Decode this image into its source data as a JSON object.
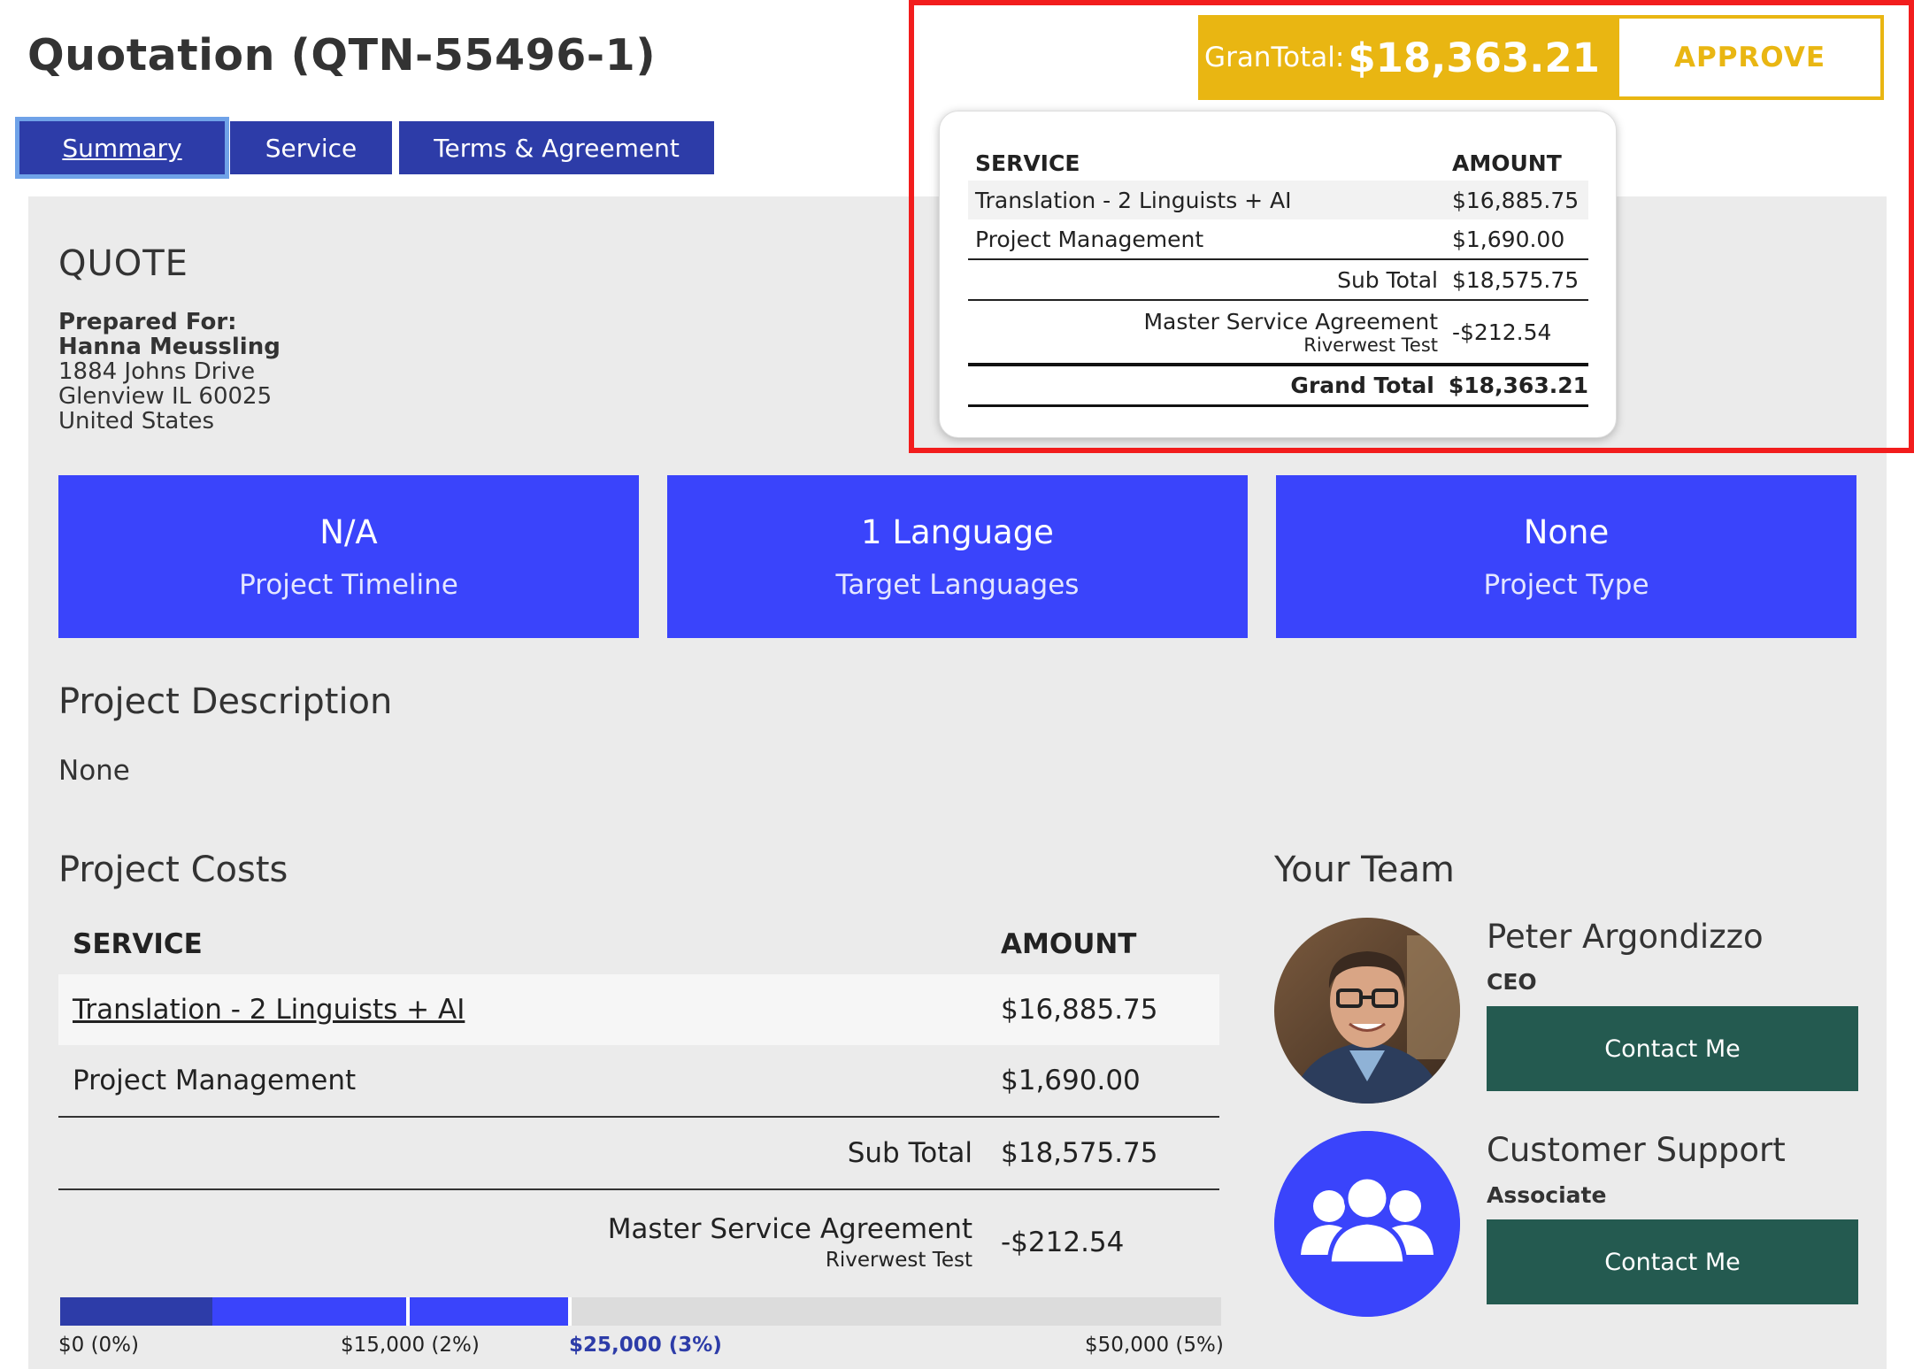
{
  "page": {
    "title": "Quotation (QTN-55496-1)"
  },
  "tabs": [
    {
      "label": "Summary",
      "active": true
    },
    {
      "label": "Service",
      "active": false
    },
    {
      "label": "Terms & Agreement",
      "active": false
    }
  ],
  "quote": {
    "heading": "QUOTE",
    "prepared_for_label": "Prepared For:",
    "client_name": "Hanna Meussling",
    "address_line1": "1884 Johns Drive",
    "address_line2": "Glenview IL 60025",
    "country": "United States"
  },
  "stats": [
    {
      "value": "N/A",
      "label": "Project Timeline"
    },
    {
      "value": "1 Language",
      "label": "Target Languages"
    },
    {
      "value": "None",
      "label": "Project Type"
    }
  ],
  "description": {
    "heading": "Project Description",
    "text": "None"
  },
  "costs": {
    "heading": "Project Costs",
    "col_service": "SERVICE",
    "col_amount": "AMOUNT",
    "rows": [
      {
        "service": "Translation - 2 Linguists + AI",
        "amount": "$16,885.75"
      },
      {
        "service": "Project Management",
        "amount": "$1,690.00"
      }
    ],
    "subtotal_label": "Sub Total",
    "subtotal_amount": "$18,575.75",
    "discount_label": "Master Service Agreement",
    "discount_sublabel": "Riverwest Test",
    "discount_amount": "-$212.54"
  },
  "progress": {
    "fill_fraction": 0.4375,
    "labels": [
      "$0 (0%)",
      "$15,000 (2%)",
      "$25,000 (3%)",
      "$50,000 (5%)"
    ],
    "highlight_index": 2,
    "colors": {
      "dark": "#2d3ca8",
      "bright": "#3a44fb",
      "track": "#dcdcdc"
    }
  },
  "team": {
    "heading": "Your Team",
    "members": [
      {
        "name": "Peter Argondizzo",
        "role": "CEO",
        "contact_label": "Contact Me",
        "avatar": "person-photo"
      },
      {
        "name": "Customer Support",
        "role": "Associate",
        "contact_label": "Contact Me",
        "avatar": "group-icon"
      }
    ]
  },
  "summary_box": {
    "banner_label": "GranTotal:",
    "banner_amount": "$18,363.21",
    "approve_label": "APPROVE",
    "col_service": "SERVICE",
    "col_amount": "AMOUNT",
    "rows": [
      {
        "service": "Translation - 2 Linguists + AI",
        "amount": "$16,885.75"
      },
      {
        "service": "Project Management",
        "amount": "$1,690.00"
      }
    ],
    "subtotal_label": "Sub Total",
    "subtotal_amount": "$18,575.75",
    "discount_label": "Master Service Agreement",
    "discount_sublabel": "Riverwest Test",
    "discount_amount": "-$212.54",
    "grand_total_label": "Grand Total",
    "grand_total_amount": "$18,363.21"
  },
  "colors": {
    "tab_bg": "#2d3ca8",
    "card_blue": "#3a44fb",
    "contact_green": "#245a50",
    "gold": "#e9b612",
    "highlight_red": "#f21d1d",
    "panel_gray": "#ebebeb"
  }
}
